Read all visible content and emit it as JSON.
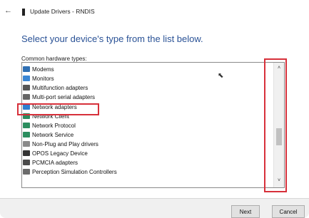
{
  "window": {
    "back_glyph": "←",
    "title": "Update Drivers - RNDIS"
  },
  "main": {
    "heading": "Select your device's type from the list below.",
    "list_label": "Common hardware types:"
  },
  "list": {
    "items": [
      {
        "label": "Modems",
        "icon": "modem-icon",
        "color": "#2f6fb3"
      },
      {
        "label": "Monitors",
        "icon": "monitor-icon",
        "color": "#3a86d4"
      },
      {
        "label": "Multifunction adapters",
        "icon": "multifunction-adapter-icon",
        "color": "#555555"
      },
      {
        "label": "Multi-port serial adapters",
        "icon": "serial-adapter-icon",
        "color": "#666666"
      },
      {
        "label": "Network adapters",
        "icon": "network-adapter-icon",
        "color": "#2f7fd0"
      },
      {
        "label": "Network Client",
        "icon": "network-client-icon",
        "color": "#2b8d5e"
      },
      {
        "label": "Network Protocol",
        "icon": "network-protocol-icon",
        "color": "#2b8d5e"
      },
      {
        "label": "Network Service",
        "icon": "network-service-icon",
        "color": "#2b8d5e"
      },
      {
        "label": "Non-Plug and Play drivers",
        "icon": "driver-icon",
        "color": "#8a8a8a"
      },
      {
        "label": "OPOS Legacy Device",
        "icon": "opos-icon",
        "color": "#333333"
      },
      {
        "label": "PCMCIA adapters",
        "icon": "pcmcia-icon",
        "color": "#4a4a4a"
      },
      {
        "label": "Perception Simulation Controllers",
        "icon": "perception-controller-icon",
        "color": "#6b6b6b"
      }
    ],
    "scroll_up": "˄",
    "scroll_down": "˅"
  },
  "footer": {
    "next_label": "Next",
    "cancel_label": "Cancel"
  },
  "colors": {
    "heading": "#2a5296",
    "annotation_red": "#d7303a"
  }
}
